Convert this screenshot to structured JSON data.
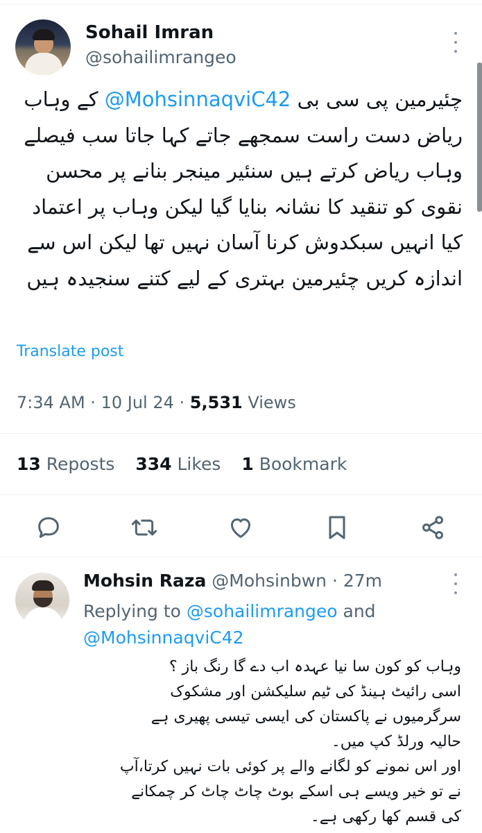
{
  "tweet": {
    "author_name": "Sohail Imran",
    "author_handle": "@sohailimrangeo",
    "text_before_mention": "چئیرمین پی سی بی ",
    "mention": "@MohsinnaqviC42",
    "text_after_mention": " کے وہاب ریاض دست راست سمجھے جاتے  کہا جاتا سب فیصلے وہاب ریاض کرتے ہیں سنئیر مینجر بنانے پر محسن نقوی کو تنقید کا نشانہ بنایا گیا لیکن وہاب پر اعتماد کیا انہیں سبکدوش کرنا آسان نہیں تھا لیکن اس سے اندازہ کریں چئیرمین بہتری کے لیے کتنے سنجیدہ ہیں",
    "translate_label": "Translate post",
    "time": "7:34 AM",
    "separator": "·",
    "date": "10 Jul 24",
    "views_count": "5,531",
    "views_label": "Views",
    "reposts_count": "13",
    "reposts_label": "Reposts",
    "likes_count": "334",
    "likes_label": "Likes",
    "bookmarks_count": "1",
    "bookmarks_label": "Bookmark"
  },
  "actions": {
    "icons": [
      "reply-icon",
      "repost-icon",
      "like-icon",
      "bookmark-icon",
      "share-icon"
    ],
    "color": "#536471"
  },
  "reply": {
    "author_name": "Mohsin Raza",
    "author_handle": "@Mohsinbwn",
    "separator": "·",
    "time": "27m",
    "replying_prefix": "Replying to ",
    "replying_mention_1": "@sohailimrangeo",
    "replying_and": " and",
    "replying_mention_2": "@MohsinnaqviC42",
    "lines": [
      "وہاب کو کون سا نیا عہدہ اب دے گا رنگ باز ؟",
      "اسی رائیٹ ہینڈ کی ٹیم سلیکشن اور مشکوک",
      "سرگرمیوں نے پاکستان کی ایسی تیسی پھیری ہے",
      "حالیہ ورلڈ کپ میں۔",
      "اور اس نمونے کو لگانے والے پر کوئی بات نہیں کرتا،آپ",
      "نے تو خیر ویسے ہی اسکے بوٹ چاٹ چاٹ کر چمکانے",
      "کی قسم کھا رکھی ہے۔"
    ]
  },
  "colors": {
    "accent": "#1d9bf0",
    "secondary_text": "#536471",
    "primary_text": "#0f1419",
    "divider": "#eff3f4"
  }
}
